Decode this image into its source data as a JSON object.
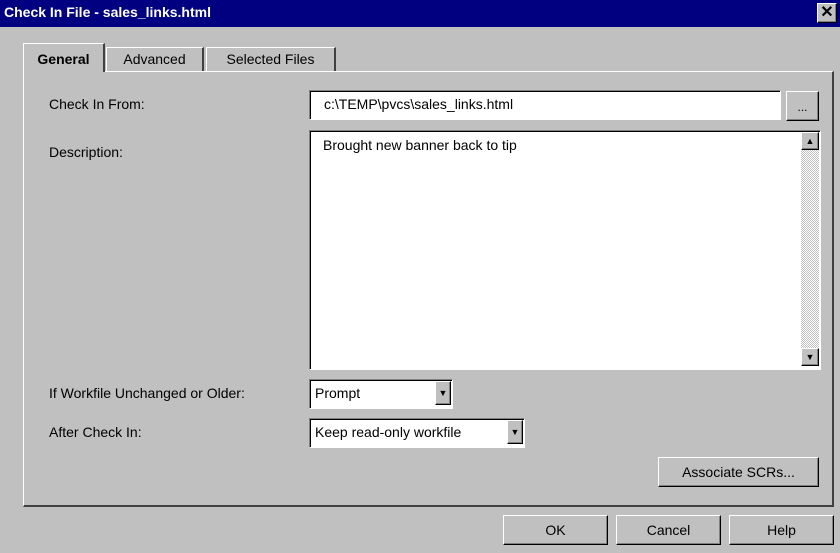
{
  "window": {
    "title": "Check In File - sales_links.html",
    "close_glyph": "✕"
  },
  "tabs": [
    {
      "label": "General",
      "active": true
    },
    {
      "label": "Advanced",
      "active": false
    },
    {
      "label": "Selected Files",
      "active": false
    }
  ],
  "form": {
    "check_in_from_label": "Check In From:",
    "check_in_from_value": "c:\\TEMP\\pvcs\\sales_links.html",
    "browse_label": "...",
    "description_label": "Description:",
    "description_value": "Brought new banner back to tip",
    "unchanged_label": "If Workfile Unchanged or Older:",
    "unchanged_value": "Prompt",
    "after_label": "After Check In:",
    "after_value": "Keep read-only workfile",
    "associate_label": "Associate SCRs..."
  },
  "buttons": {
    "ok": "OK",
    "cancel": "Cancel",
    "help": "Help"
  },
  "glyphs": {
    "up_arrow": "▲",
    "down_arrow": "▼"
  },
  "colors": {
    "titlebar": "#000080",
    "face": "#c0c0c0"
  }
}
